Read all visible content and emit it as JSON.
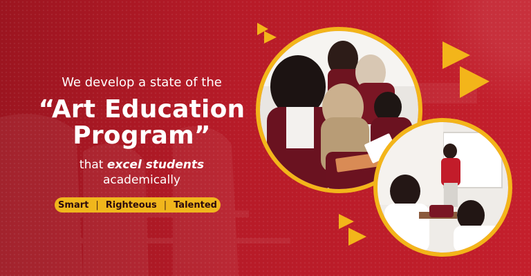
{
  "headline": {
    "line1": "We develop a state of the",
    "main_line1": "“Art Education",
    "main_line2": "Program”",
    "line3_prefix": "that",
    "line3_emphasis": "excel students",
    "line4": "academically"
  },
  "tags": {
    "items": [
      "Smart",
      "Righteous",
      "Talented"
    ],
    "separator": "|"
  },
  "colors": {
    "background_red": "#b71b28",
    "accent_yellow": "#f3b51a",
    "text_white": "#ffffff",
    "pill_text": "#2b0a0e"
  },
  "images": {
    "photo_top": "classroom-students-reading-photo",
    "photo_bottom": "classroom-teacher-whiteboard-photo"
  }
}
